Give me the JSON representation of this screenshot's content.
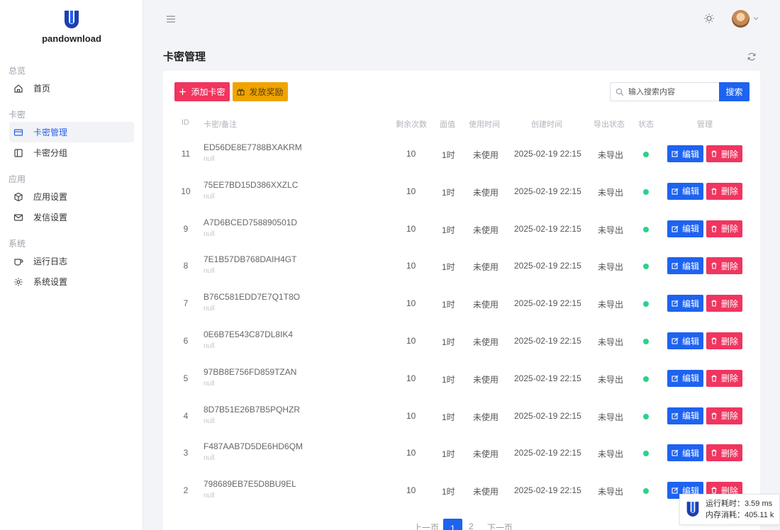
{
  "app": {
    "name": "pandownload",
    "logo_letter": "U",
    "accent": "#1e63f0",
    "danger": "#f0355f",
    "warning": "#f0a400",
    "success": "#2bd28a"
  },
  "sidebar": {
    "groups": [
      {
        "label": "总览",
        "items": [
          {
            "label": "首页",
            "icon": "home-icon",
            "active": false
          }
        ]
      },
      {
        "label": "卡密",
        "items": [
          {
            "label": "卡密管理",
            "icon": "card-icon",
            "active": true
          },
          {
            "label": "卡密分组",
            "icon": "columns-icon",
            "active": false
          }
        ]
      },
      {
        "label": "应用",
        "items": [
          {
            "label": "应用设置",
            "icon": "cube-icon",
            "active": false
          },
          {
            "label": "发信设置",
            "icon": "mail-icon",
            "active": false
          }
        ]
      },
      {
        "label": "系统",
        "items": [
          {
            "label": "运行日志",
            "icon": "cup-icon",
            "active": false
          },
          {
            "label": "系统设置",
            "icon": "gear-icon",
            "active": false
          }
        ]
      }
    ]
  },
  "page": {
    "title": "卡密管理"
  },
  "toolbar": {
    "add_label": "添加卡密",
    "reward_label": "发放奖励",
    "search_placeholder": "输入搜索内容",
    "search_label": "搜索"
  },
  "table": {
    "headers": [
      "ID",
      "卡密/备注",
      "剩余次数",
      "面值",
      "使用时间",
      "创建时间",
      "导出状态",
      "状态",
      "管理"
    ],
    "edit_label": "编辑",
    "delete_label": "删除",
    "rows": [
      {
        "id": "11",
        "card": "ED56DE8E7788BXAKRM",
        "note": "null",
        "remaining": "10",
        "value": "1时",
        "used_time": "未使用",
        "created": "2025-02-19 22:15",
        "export": "未导出",
        "status": "active"
      },
      {
        "id": "10",
        "card": "75EE7BD15D386XXZLC",
        "note": "null",
        "remaining": "10",
        "value": "1时",
        "used_time": "未使用",
        "created": "2025-02-19 22:15",
        "export": "未导出",
        "status": "active"
      },
      {
        "id": "9",
        "card": "A7D6BCED758890501D",
        "note": "null",
        "remaining": "10",
        "value": "1时",
        "used_time": "未使用",
        "created": "2025-02-19 22:15",
        "export": "未导出",
        "status": "active"
      },
      {
        "id": "8",
        "card": "7E1B57DB768DAIH4GT",
        "note": "null",
        "remaining": "10",
        "value": "1时",
        "used_time": "未使用",
        "created": "2025-02-19 22:15",
        "export": "未导出",
        "status": "active"
      },
      {
        "id": "7",
        "card": "B76C581EDD7E7Q1T8O",
        "note": "null",
        "remaining": "10",
        "value": "1时",
        "used_time": "未使用",
        "created": "2025-02-19 22:15",
        "export": "未导出",
        "status": "active"
      },
      {
        "id": "6",
        "card": "0E6B7E543C87DL8IK4",
        "note": "null",
        "remaining": "10",
        "value": "1时",
        "used_time": "未使用",
        "created": "2025-02-19 22:15",
        "export": "未导出",
        "status": "active"
      },
      {
        "id": "5",
        "card": "97BB8E756FD859TZAN",
        "note": "null",
        "remaining": "10",
        "value": "1时",
        "used_time": "未使用",
        "created": "2025-02-19 22:15",
        "export": "未导出",
        "status": "active"
      },
      {
        "id": "4",
        "card": "8D7B51E26B7B5PQHZR",
        "note": "null",
        "remaining": "10",
        "value": "1时",
        "used_time": "未使用",
        "created": "2025-02-19 22:15",
        "export": "未导出",
        "status": "active"
      },
      {
        "id": "3",
        "card": "F487AAB7D5DE6HD6QM",
        "note": "null",
        "remaining": "10",
        "value": "1时",
        "used_time": "未使用",
        "created": "2025-02-19 22:15",
        "export": "未导出",
        "status": "active"
      },
      {
        "id": "2",
        "card": "798689EB7E5D8BU9EL",
        "note": "null",
        "remaining": "10",
        "value": "1时",
        "used_time": "未使用",
        "created": "2025-02-19 22:15",
        "export": "未导出",
        "status": "active"
      }
    ]
  },
  "pagination": {
    "prev_label": "上一页",
    "current": "1",
    "next_page": "2",
    "next_label": "下一页"
  },
  "perf": {
    "runtime": "运行耗时：3.59 ms",
    "memory": "内存消耗：405.11 k"
  }
}
